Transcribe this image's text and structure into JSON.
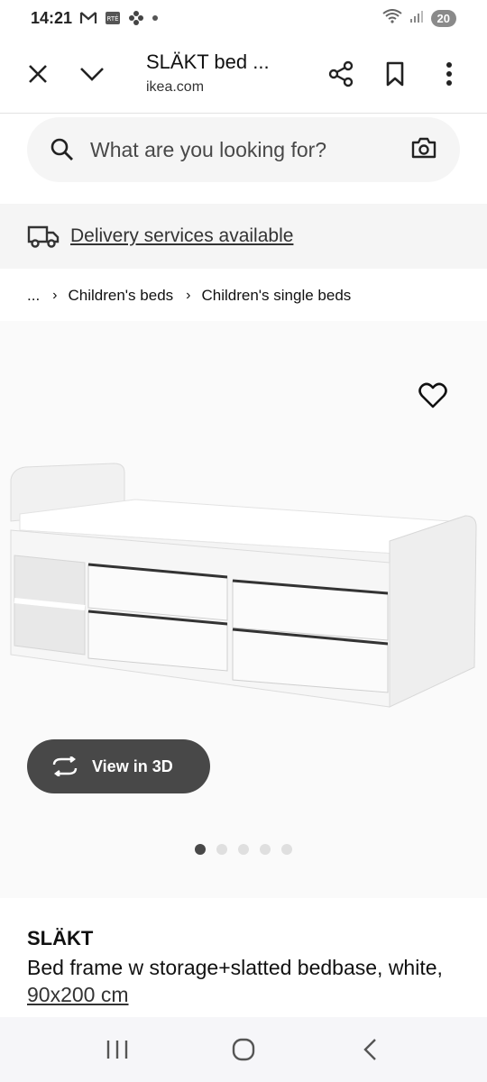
{
  "status_bar": {
    "time": "14:21",
    "battery": "20",
    "icons": [
      "gmail-icon",
      "rte-icon",
      "pinwheel-icon",
      "dot-icon",
      "wifi-icon",
      "signal-icon"
    ]
  },
  "toolbar": {
    "title": "SLÄKT bed ...",
    "url": "ikea.com",
    "icons": [
      "close-icon",
      "chevron-down-icon",
      "share-icon",
      "bookmark-icon",
      "more-vert-icon"
    ]
  },
  "search": {
    "placeholder": "What are you looking for?",
    "value": ""
  },
  "delivery": {
    "label": "Delivery services available"
  },
  "breadcrumb": {
    "items": [
      "...",
      "Children's beds",
      "Children's single beds"
    ]
  },
  "product_image": {
    "view3d_label": "View in 3D",
    "slide_count": 5,
    "active_slide": 1
  },
  "product": {
    "name": "SLÄKT",
    "description": "Bed frame w storage+slatted bedbase, white, ",
    "size": "90x200 cm"
  },
  "colors": {
    "accent_dark": "#484848",
    "search_bg": "#f5f5f5",
    "navbar_bg": "#f6f6f9"
  }
}
